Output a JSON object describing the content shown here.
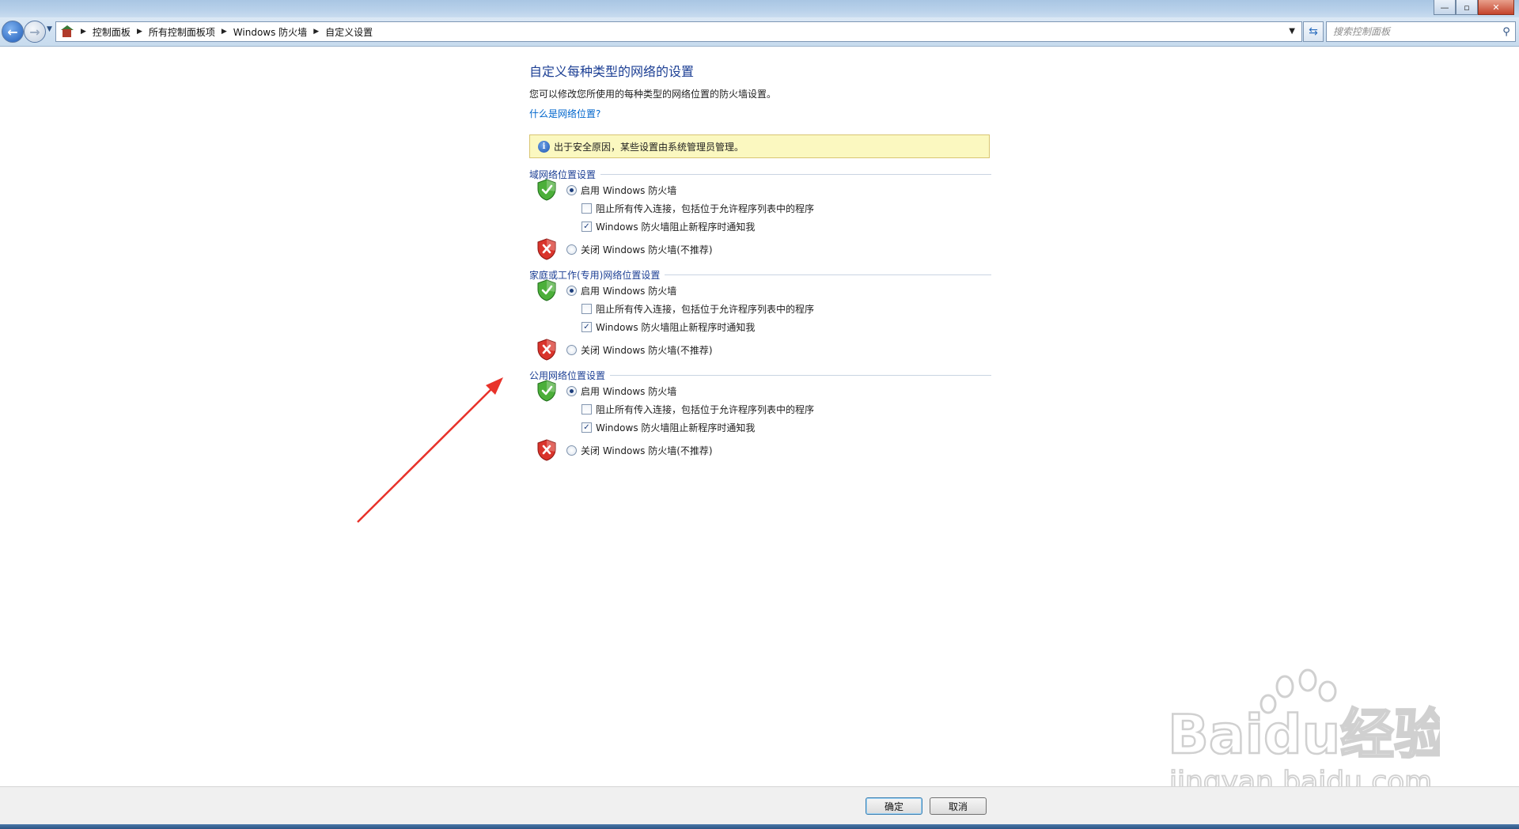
{
  "address_bar": {
    "breadcrumbs": [
      "控制面板",
      "所有控制面板项",
      "Windows 防火墙",
      "自定义设置"
    ],
    "search_placeholder": "搜索控制面板"
  },
  "content": {
    "title": "自定义每种类型的网络的设置",
    "description": "您可以修改您所使用的每种类型的网络位置的防火墙设置。",
    "link": "什么是网络位置?",
    "info_message": "出于安全原因，某些设置由系统管理员管理。"
  },
  "sections": [
    {
      "title": "域网络位置设置",
      "enable_label": "启用 Windows 防火墙",
      "enable_selected": true,
      "block_label": "阻止所有传入连接，包括位于允许程序列表中的程序",
      "block_checked": false,
      "notify_label": "Windows 防火墙阻止新程序时通知我",
      "notify_checked": true,
      "disable_label": "关闭 Windows 防火墙(不推荐)"
    },
    {
      "title": "家庭或工作(专用)网络位置设置",
      "enable_label": "启用 Windows 防火墙",
      "enable_selected": true,
      "block_label": "阻止所有传入连接，包括位于允许程序列表中的程序",
      "block_checked": false,
      "notify_label": "Windows 防火墙阻止新程序时通知我",
      "notify_checked": true,
      "disable_label": "关闭 Windows 防火墙(不推荐)"
    },
    {
      "title": "公用网络位置设置",
      "enable_label": "启用 Windows 防火墙",
      "enable_selected": true,
      "block_label": "阻止所有传入连接，包括位于允许程序列表中的程序",
      "block_checked": false,
      "notify_label": "Windows 防火墙阻止新程序时通知我",
      "notify_checked": true,
      "disable_label": "关闭 Windows 防火墙(不推荐)"
    }
  ],
  "buttons": {
    "ok": "确定",
    "cancel": "取消"
  },
  "watermark": {
    "logo": "Baidu经验",
    "url": "jingyan.baidu.com"
  },
  "colors": {
    "heading": "#1c3f94",
    "link": "#0066cc",
    "info_bg": "#fbf8c0",
    "arrow": "#e8322a"
  }
}
